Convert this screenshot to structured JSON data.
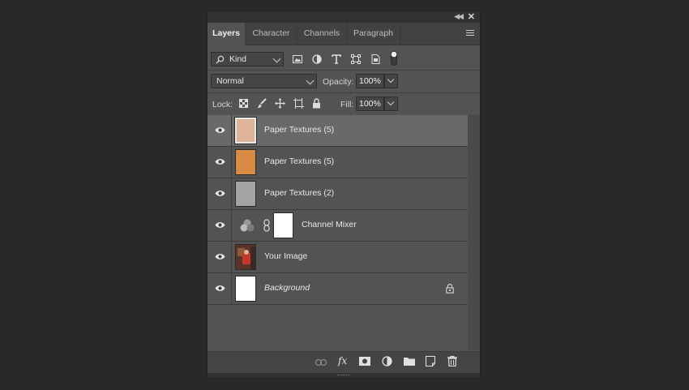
{
  "panel": {
    "tabs": [
      {
        "label": "Layers",
        "active": true
      },
      {
        "label": "Character",
        "active": false
      },
      {
        "label": "Channels",
        "active": false
      },
      {
        "label": "Paragraph",
        "active": false
      }
    ],
    "filter": {
      "label": "Kind",
      "icons": [
        "image-filter-icon",
        "adjustment-filter-icon",
        "type-filter-icon",
        "shape-filter-icon",
        "smart-object-filter-icon",
        "filter-toggle-icon"
      ]
    },
    "blend_mode": "Normal",
    "opacity_label": "Opacity:",
    "opacity_value": "100%",
    "lock_label": "Lock:",
    "lock_icons": [
      "lock-transparent-icon",
      "lock-paint-icon",
      "lock-position-icon",
      "lock-artboard-icon",
      "lock-all-icon"
    ],
    "fill_label": "Fill:",
    "fill_value": "100%"
  },
  "layers": [
    {
      "name": "Paper Textures (5)",
      "selected": true,
      "thumb": "#ddb39a"
    },
    {
      "name": "Paper Textures (5)",
      "selected": false,
      "thumb": "#d98a45"
    },
    {
      "name": "Paper Textures (2)",
      "selected": false,
      "thumb": "#a3a3a3"
    },
    {
      "name": "Channel Mixer",
      "selected": false,
      "type": "adjustment"
    },
    {
      "name": "Your Image",
      "selected": false,
      "thumb": "#6a3c30"
    },
    {
      "name": "Background",
      "selected": false,
      "thumb": "#ffffff",
      "italic": true,
      "locked": true
    }
  ],
  "bottom_icons": [
    "link-layers-icon",
    "fx-icon",
    "add-mask-icon",
    "new-adjustment-icon",
    "new-group-icon",
    "new-layer-icon",
    "delete-layer-icon"
  ],
  "bottom_fx_label": "fx",
  "colors": {
    "panel_bg": "#535353",
    "selected_row": "#696969",
    "app_bg": "#282828"
  }
}
